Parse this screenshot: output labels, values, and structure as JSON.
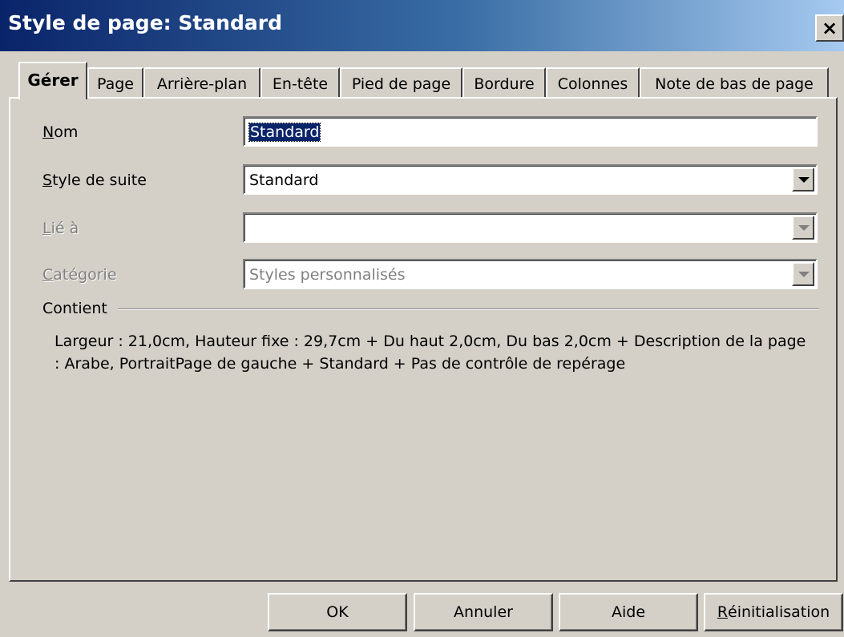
{
  "window": {
    "title": "Style de page: Standard",
    "close_glyph": "×"
  },
  "tabs": [
    {
      "label": "Gérer",
      "active": true
    },
    {
      "label": "Page"
    },
    {
      "label": "Arrière-plan"
    },
    {
      "label": "En-tête"
    },
    {
      "label": "Pied de page"
    },
    {
      "label": "Bordure"
    },
    {
      "label": "Colonnes"
    },
    {
      "label": "Note de bas de page"
    }
  ],
  "form": {
    "nom": {
      "label_mnemonic": "N",
      "label_rest": "om",
      "value": "Standard"
    },
    "style_suite": {
      "label_mnemonic": "S",
      "label_rest": "tyle de suite",
      "value": "Standard"
    },
    "lie_a": {
      "label_mnemonic": "L",
      "label_rest": "ié à",
      "value": "",
      "disabled": true
    },
    "categorie": {
      "label_mnemonic": "C",
      "label_rest": "atégorie",
      "value": "Styles personnalisés",
      "disabled": true
    }
  },
  "contient": {
    "label": "Contient",
    "text": "Largeur : 21,0cm, Hauteur fixe : 29,7cm + Du haut 2,0cm, Du bas 2,0cm + Description de la page : Arabe, PortraitPage de gauche + Standard + Pas de contrôle de repérage"
  },
  "buttons": {
    "ok": "OK",
    "annuler": "Annuler",
    "aide": "Aide",
    "reinit_mnemonic": "R",
    "reinit_rest": "éinitialisation"
  }
}
